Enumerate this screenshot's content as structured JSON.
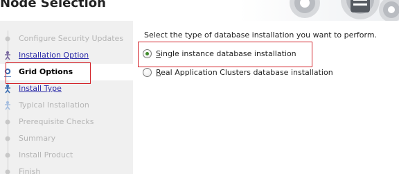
{
  "header": {
    "title": "Node Selection"
  },
  "sidebar": {
    "steps": [
      {
        "label": "Configure Security Updates",
        "state": "done"
      },
      {
        "label": "Installation Option",
        "state": "link"
      },
      {
        "label": "Grid Options",
        "state": "current"
      },
      {
        "label": "Install Type",
        "state": "link"
      },
      {
        "label": "Typical Installation",
        "state": "pending"
      },
      {
        "label": "Prerequisite Checks",
        "state": "pending"
      },
      {
        "label": "Summary",
        "state": "pending"
      },
      {
        "label": "Install Product",
        "state": "pending"
      },
      {
        "label": "Finish",
        "state": "pending"
      }
    ]
  },
  "main": {
    "prompt": "Select the type of database installation you want to perform.",
    "options": [
      {
        "mnemonic": "S",
        "rest": "ingle instance database installation",
        "selected": true
      },
      {
        "mnemonic": "R",
        "rest": "eal Application Clusters database installation",
        "selected": false
      }
    ]
  },
  "colors": {
    "highlight": "#d3232a",
    "link": "#2a2aa8",
    "radio_dot": "#3f8a2a"
  },
  "icons": [
    "gear-icon",
    "database-icon",
    "step-dot-icon",
    "step-figure-icon"
  ]
}
